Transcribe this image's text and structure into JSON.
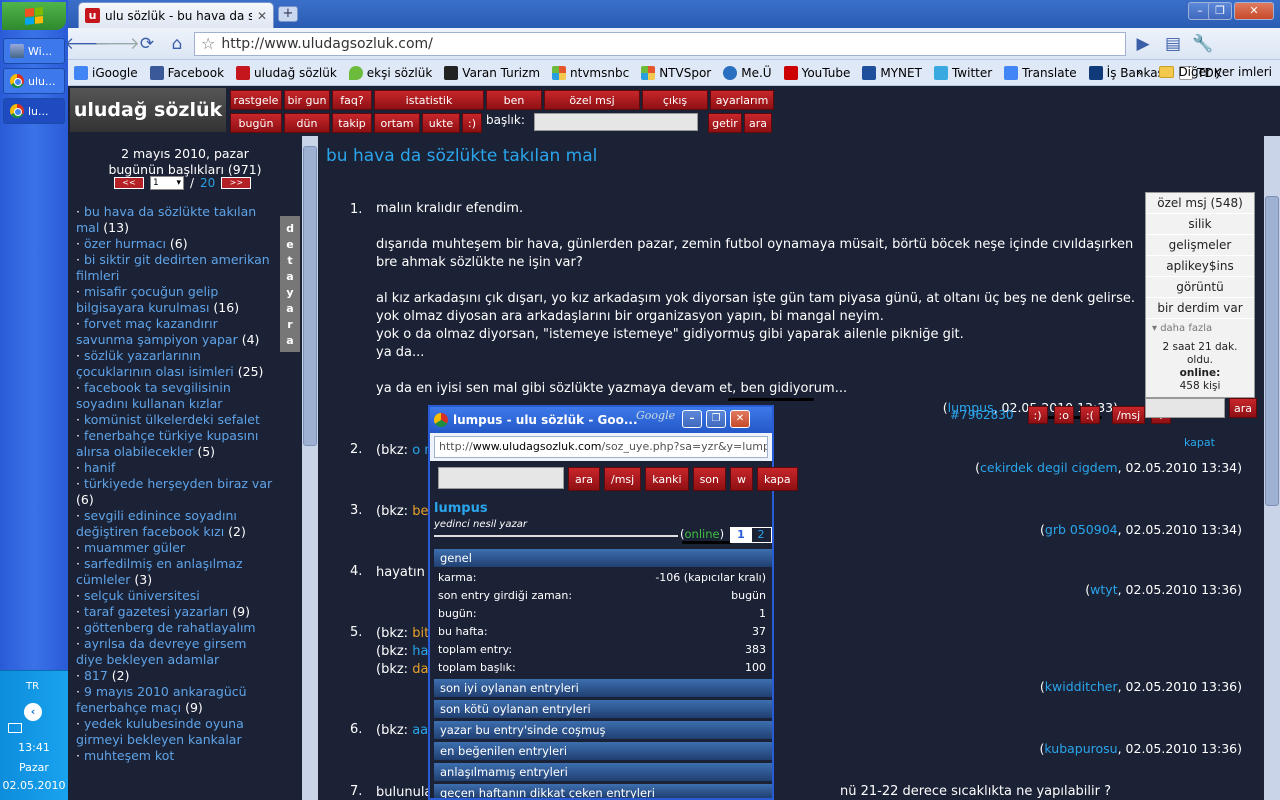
{
  "taskbar": {
    "items": [
      {
        "label": "Wi..."
      },
      {
        "label": "ulu..."
      },
      {
        "label": "lu..."
      }
    ],
    "tray": {
      "lang": "TR",
      "time": "13:41",
      "day": "Pazar",
      "date": "02.05.2010"
    }
  },
  "browser": {
    "tab_title": "ulu sözlük - bu hava da sözlükte",
    "url": "http://www.uludagsozluk.com/",
    "bookmarks": [
      {
        "label": "iGoogle",
        "color": "#4285f4"
      },
      {
        "label": "Facebook",
        "color": "#3b5998"
      },
      {
        "label": "uludağ sözlük",
        "color": "#c4161c"
      },
      {
        "label": "ekşi sözlük",
        "color": "#6dbb3c"
      },
      {
        "label": "Varan Turizm",
        "color": "#222222"
      },
      {
        "label": "ntvmsnbc",
        "color": "#e4572e"
      },
      {
        "label": "NTVSpor",
        "color": "#e4572e"
      },
      {
        "label": "Me.Ü",
        "color": "#2a6fbf"
      },
      {
        "label": "YouTube",
        "color": "#cc0000"
      },
      {
        "label": "MYNET",
        "color": "#1d4f9c"
      },
      {
        "label": "Twitter",
        "color": "#39a9e0"
      },
      {
        "label": "Translate",
        "color": "#4285f4"
      },
      {
        "label": "İş Bankası",
        "color": "#0f3b7a"
      },
      {
        "label": "TDK",
        "color": "#ffffff"
      }
    ],
    "other_bookmarks": "Diğer yer imleri"
  },
  "site": {
    "logo": "uludağ sözlük",
    "nav_top": [
      "rastgele",
      "bir gun",
      "faq?",
      "istatistik",
      "ben",
      "özel msj",
      "çıkış",
      "ayarlarım"
    ],
    "nav_bottom": [
      "bugün",
      "dün",
      "takip",
      "ortam",
      "ukte",
      ":)"
    ],
    "baslik_label": "başlık:",
    "getir": "getir",
    "ara": "ara"
  },
  "left": {
    "date_line1": "2 mayıs 2010, pazar",
    "date_line2": "bugünün başlıkları (971)",
    "prev": "<<",
    "page": "1",
    "sep": "/",
    "total_pages": "20",
    "next": ">>",
    "detay": [
      "d",
      "e",
      "t",
      "a",
      "y"
    ],
    "ara_letters": [
      "a",
      "r",
      "a"
    ],
    "topics": [
      {
        "title": "bu hava da sözlükte takılan mal",
        "count": "(13)"
      },
      {
        "title": "özer hurmacı",
        "count": "(6)"
      },
      {
        "title": "bi siktir git dedirten amerikan filmleri",
        "count": ""
      },
      {
        "title": "misafir çocuğun gelip bilgisayara kurulması",
        "count": "(16)"
      },
      {
        "title": "forvet maç kazandırır savunma şampiyon yapar",
        "count": "(4)"
      },
      {
        "title": "sözlük yazarlarının çocuklarının olası isimleri",
        "count": "(25)"
      },
      {
        "title": "facebook ta sevgilisinin soyadını kullanan kızlar",
        "count": ""
      },
      {
        "title": "komünist ülkelerdeki sefalet",
        "count": ""
      },
      {
        "title": "fenerbahçe türkiye kupasını alırsa olabilecekler",
        "count": "(5)"
      },
      {
        "title": "hanif",
        "count": ""
      },
      {
        "title": "türkiyede herşeyden biraz var",
        "count": "(6)"
      },
      {
        "title": "sevgili edinince soyadını değiştiren facebook kızı",
        "count": "(2)"
      },
      {
        "title": "muammer güler",
        "count": ""
      },
      {
        "title": "sarfedilmiş en anlaşılmaz cümleler",
        "count": "(3)"
      },
      {
        "title": "selçuk üniversitesi",
        "count": ""
      },
      {
        "title": "taraf gazetesi yazarları",
        "count": "(9)"
      },
      {
        "title": "göttenberg de rahatlayalım",
        "count": ""
      },
      {
        "title": "ayrılsa da devreye girsem diye bekleyen adamlar",
        "count": ""
      },
      {
        "title": "817",
        "count": "(2)"
      },
      {
        "title": "9 mayıs 2010 ankaragücü fenerbahçe maçı",
        "count": "(9)"
      },
      {
        "title": "yedek kulubesinde oyuna girmeyi bekleyen kankalar",
        "count": ""
      },
      {
        "title": "muhteşem kot",
        "count": ""
      }
    ]
  },
  "main": {
    "title": "bu hava da sözlükte takılan mal",
    "entry1": {
      "num": "1.",
      "p1": "malın kralıdır efendim.",
      "p2": "dışarıda muhteşem bir hava, günlerden pazar, zemin futbol oynamaya müsait, börtü böcek neşe içinde cıvıldaşırken bre ahmak sözlükte ne işin var?",
      "p3a": "al kız arkadaşını çık dışarı, yo kız arkadaşım yok diyorsan işte gün tam piyasa günü, at oltanı üç beş ne denk gelirse.",
      "p3b": "yok olmaz diyosan ara arkadaşlarını bir organizasyon yapın, bi mangal neyim.",
      "p3c": "yok o da olmaz diyorsan, \"istemeye istemeye\" gidiyormuş gibi yaparak ailenle pikniğe git.",
      "p3d": "ya da...",
      "p4": "ya da en iyisi sen mal gibi sözlükte yazmaya devam et, ben gidiyorum...",
      "author": "lumpus",
      "date": ", 02.05.2010 13:33)",
      "open": "(",
      "id": "#7962830",
      "tools": [
        ":)",
        ":o",
        ":(",
        "/msj",
        "?"
      ]
    },
    "entries": [
      {
        "num": "2.",
        "prefix": "(bkz: ",
        "link": "o m",
        "author": "cekirdek degil cigdem",
        "date": ", 02.05.2010 13:34)"
      },
      {
        "num": "3.",
        "prefix": "(bkz: ",
        "link": "be",
        "author": "grb 050904",
        "date": ", 02.05.2010 13:34)"
      },
      {
        "num": "4.",
        "prefix": "hayatın",
        "link": "",
        "author": "wtyt",
        "date": ", 02.05.2010 13:36)"
      },
      {
        "num": "5.",
        "prefix": "(bkz: ",
        "link": "bit",
        "author": "kwidditcher",
        "date": ", 02.05.2010 13:36)"
      },
      {
        "num": "6.",
        "prefix": "(bkz: ",
        "link": "aa",
        "author": "kubapurosu",
        "date": ", 02.05.2010 13:36)"
      },
      {
        "num": "7.",
        "prefix": "bulunula",
        "link": "",
        "author": "",
        "date": ""
      }
    ],
    "entry5_extra": [
      {
        "prefix": "(bkz: ",
        "link": "ha"
      },
      {
        "prefix": "(bkz: ",
        "link": "da"
      }
    ],
    "entry7_tail": "nü 21-22 derece sıcaklıkta ne yapılabilir ?"
  },
  "user_menu": {
    "items": [
      "özel msj (548)",
      "silik",
      "gelişmeler",
      "aplikey$ins",
      "görüntü",
      "bir derdim var"
    ],
    "more": "daha fazla",
    "since": "2 saat 21 dak. oldu.",
    "online_label": "online:",
    "online_count": "458 kişi",
    "ara": "ara",
    "kapat": "kapat"
  },
  "popup": {
    "title": "lumpus - ulu sözlük - Goo...",
    "google": "Google",
    "url_pre": "http://",
    "url_host": "www.uludagsozluk.com",
    "url_post": "/soz_uye.php?sa=yzr&y=lumpus",
    "buttons": [
      "ara",
      "/msj",
      "kanki",
      "son",
      "w",
      "kapa"
    ],
    "username": "lumpus",
    "rank": "yedinci nesil yazar",
    "online_open": "(",
    "online_word": "online",
    "online_close": ")",
    "pages": [
      "1",
      "2"
    ],
    "genel": "genel",
    "stats": [
      {
        "label": "karma:",
        "value": "-106 (kapıcılar kralı)"
      },
      {
        "label": "son entry girdiği zaman:",
        "value": "bugün"
      },
      {
        "label": "bugün:",
        "value": "1"
      },
      {
        "label": "bu hafta:",
        "value": "37"
      },
      {
        "label": "toplam entry:",
        "value": "383"
      },
      {
        "label": "toplam başlık:",
        "value": "100"
      }
    ],
    "sections": [
      "son iyi oylanan entryleri",
      "son kötü oylanan entryleri",
      "yazar bu entry'sinde coşmuş",
      "en beğenilen entryleri",
      "anlaşılmamış entryleri",
      "geçen haftanın dikkat çeken entryleri"
    ]
  }
}
